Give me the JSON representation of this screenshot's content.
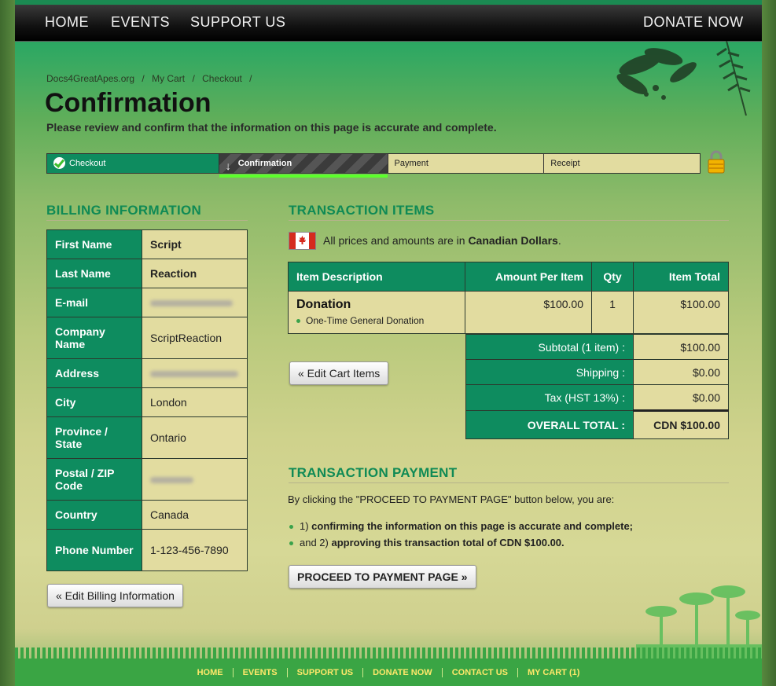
{
  "nav": {
    "home": "HOME",
    "events": "EVENTS",
    "support": "SUPPORT US",
    "donate": "DONATE NOW"
  },
  "breadcrumb": {
    "site": "Docs4GreatApes.org",
    "cart": "My Cart",
    "checkout": "Checkout",
    "sep": "/"
  },
  "page": {
    "title": "Confirmation",
    "subtitle": "Please review and confirm that the information on this page is accurate and complete."
  },
  "steps": [
    {
      "label": "Checkout",
      "state": "done"
    },
    {
      "label": "Confirmation",
      "state": "active"
    },
    {
      "label": "Payment",
      "state": "pending"
    },
    {
      "label": "Receipt",
      "state": "pending"
    }
  ],
  "billing": {
    "heading": "BILLING INFORMATION",
    "rows": [
      {
        "label": "First Name",
        "value": "Script"
      },
      {
        "label": "Last Name",
        "value": "Reaction"
      },
      {
        "label": "E-mail",
        "value": ""
      },
      {
        "label": "Company Name",
        "value": "ScriptReaction"
      },
      {
        "label": "Address",
        "value": ""
      },
      {
        "label": "City",
        "value": "London"
      },
      {
        "label": "Province / State",
        "value": "Ontario"
      },
      {
        "label": "Postal / ZIP Code",
        "value": ""
      },
      {
        "label": "Country",
        "value": "Canada"
      },
      {
        "label": "Phone Number",
        "value": "1-123-456-7890"
      }
    ],
    "edit_button": "« Edit Billing Information"
  },
  "transaction": {
    "heading": "TRANSACTION ITEMS",
    "note_prefix": "All prices and amounts are in ",
    "note_currency": "Canadian Dollars",
    "note_suffix": ".",
    "columns": {
      "desc": "Item Description",
      "amount": "Amount Per Item",
      "qty": "Qty",
      "total": "Item Total"
    },
    "item": {
      "name": "Donation",
      "detail": "One-Time General Donation",
      "amount": "$100.00",
      "qty": "1",
      "total": "$100.00"
    },
    "edit_cart": "« Edit Cart Items",
    "subtotal_label": "Subtotal (1 item) :",
    "subtotal": "$100.00",
    "shipping_label": "Shipping :",
    "shipping": "$0.00",
    "tax_label": "Tax (HST 13%) :",
    "tax": "$0.00",
    "overall_label": "OVERALL TOTAL :",
    "overall": "CDN $100.00"
  },
  "payment": {
    "heading": "TRANSACTION PAYMENT",
    "intro": "By clicking the \"PROCEED TO PAYMENT PAGE\" button below, you are:",
    "bullet1_prefix": "1) ",
    "bullet1_bold": "confirming the information on this page is accurate and complete;",
    "bullet2_prefix": "and 2) ",
    "bullet2_bold": "approving this transaction total of CDN $100.00.",
    "proceed_button": "PROCEED TO PAYMENT PAGE »"
  },
  "footer": {
    "links": [
      "HOME",
      "EVENTS",
      "SUPPORT US",
      "DONATE NOW",
      "CONTACT US",
      "MY CART (1)"
    ]
  },
  "colors": {
    "brand_green": "#0e8c5f",
    "heading_green": "#0f8a55",
    "cell_bg": "#e2dca0",
    "footer_link": "#ffe86a"
  }
}
